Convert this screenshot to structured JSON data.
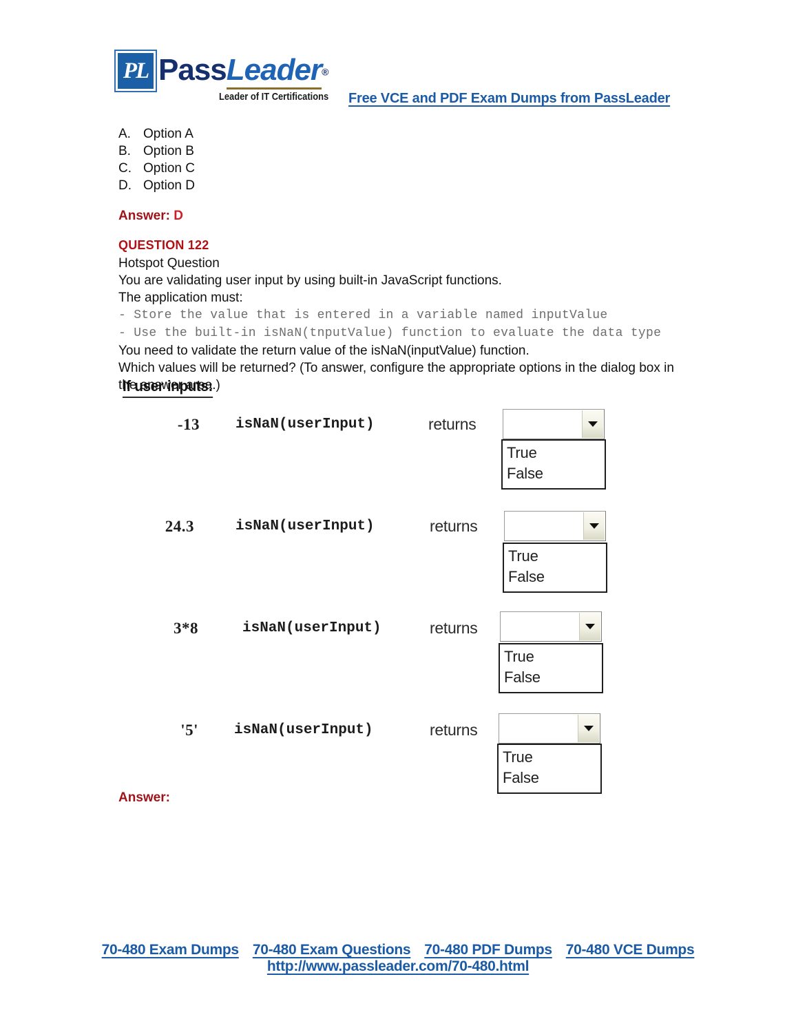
{
  "header": {
    "logo_badge": "PL",
    "logo_pass": "Pass",
    "logo_leader": "Leader",
    "logo_reg": "®",
    "tagline": "Leader of IT Certifications",
    "promo_link": "Free VCE and PDF Exam Dumps from PassLeader",
    "brand_blue": "#1b5ba5",
    "logo_navy": "#16306e"
  },
  "options": [
    {
      "letter": "A.",
      "label": "Option A"
    },
    {
      "letter": "B.",
      "label": "Option B"
    },
    {
      "letter": "C.",
      "label": "Option C"
    },
    {
      "letter": "D.",
      "label": "Option D"
    }
  ],
  "previous_answer": {
    "label": "Answer:",
    "value": "D"
  },
  "question": {
    "number": "QUESTION 122",
    "type": "Hotspot Question",
    "line1": "You are validating user input by using built-in JavaScript functions.",
    "line2": "The application must:",
    "bullet1": "- Store the value that is entered in a variable named inputValue",
    "bullet2": "- Use the built-in isNaN(tnputValue) function to evaluate the data type",
    "line3": "You need to validate the return value of the isNaN(inputValue) function.",
    "line4": "Which values will be returned? (To answer, configure the appropriate options in the dialog box in the answer area.)",
    "accent_color": "#b01116"
  },
  "hotspot": {
    "title": "If user inputs:",
    "returns_label": "returns",
    "dropdown_options": [
      "True",
      "False"
    ],
    "rows": [
      {
        "input": "-13",
        "code": "isNaN(userInput)",
        "returns": "returns",
        "selected": ""
      },
      {
        "input": "24.3",
        "code": "isNaN(userInput)",
        "returns": "returns",
        "selected": ""
      },
      {
        "input": "3*8",
        "code": "isNaN(userInput)",
        "returns": "returns",
        "selected": ""
      },
      {
        "input": "'5'",
        "code": "isNaN(userInput)",
        "returns": "returns",
        "selected": ""
      }
    ]
  },
  "answer_blank": {
    "label": "Answer:"
  },
  "footer": {
    "links": [
      "70-480 Exam Dumps",
      "70-480 Exam Questions",
      "70-480 PDF Dumps",
      "70-480 VCE Dumps"
    ],
    "url": "http://www.passleader.com/70-480.html"
  }
}
